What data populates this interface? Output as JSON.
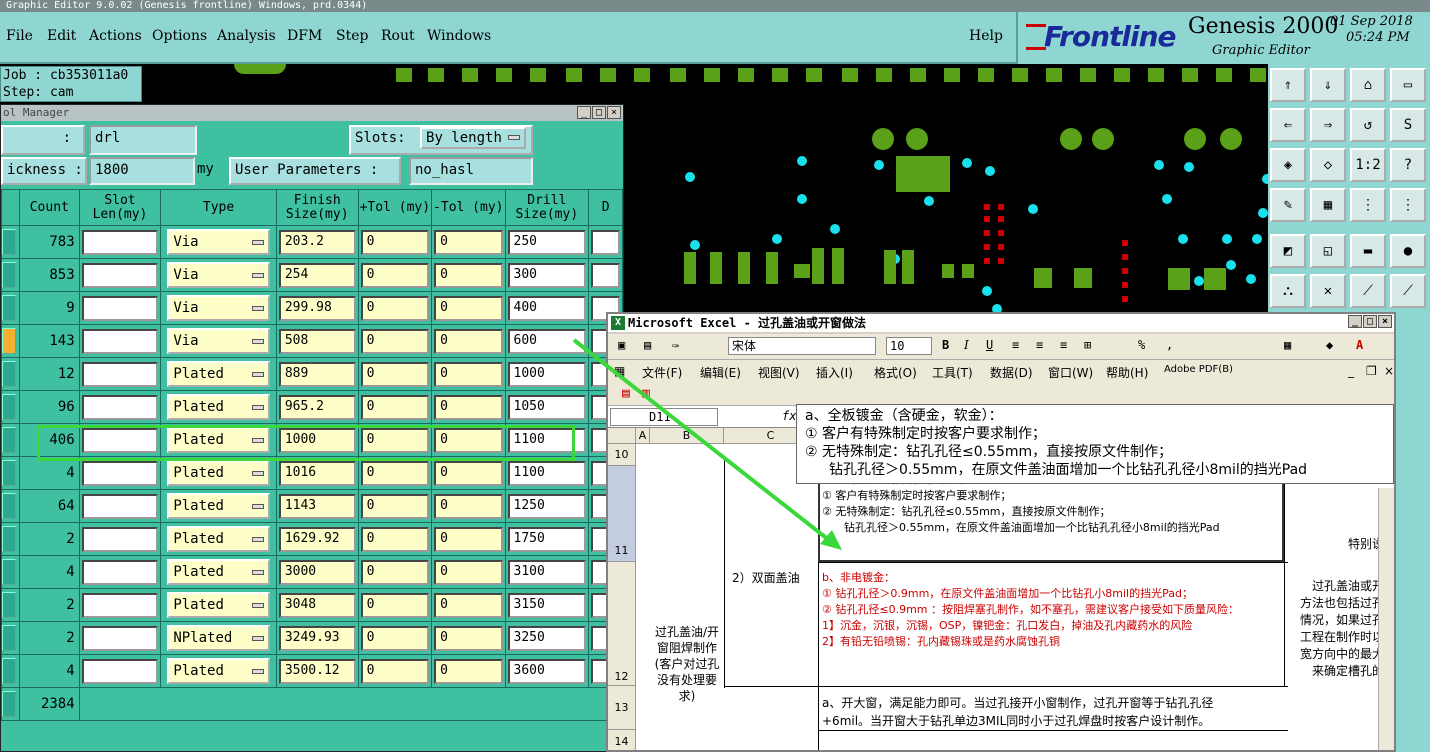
{
  "app": {
    "title_strip": "Graphic Editor 9.0.02 (Genesis  frontline) Windows, prd.0344)",
    "menu": [
      "File",
      "Edit",
      "Actions",
      "Options",
      "Analysis",
      "DFM",
      "Step",
      "Rout",
      "Windows"
    ],
    "help": "Help",
    "brand_logo": "Frontline",
    "product": "Genesis 2000",
    "product_sub": "Graphic Editor",
    "date": "01 Sep 2018",
    "time": "05:24 PM",
    "job": "Job : cb353011a0",
    "step": "Step: cam"
  },
  "toolmgr": {
    "title": "ol Manager",
    "layer_label": ":",
    "layer_value": "drl",
    "slots_label": "Slots:",
    "slots_value": "By length",
    "thickness_label": "ickness :",
    "thickness_value": "1800",
    "thickness_unit": "my",
    "user_params_label": "User Parameters :",
    "user_params_value": "no_hasl",
    "headers": [
      "Count",
      "Slot Len(my)",
      "Type",
      "Finish Size(my)",
      "+Tol (my)",
      "-Tol (my)",
      "Drill Size(my)",
      "D"
    ],
    "rows": [
      {
        "count": "783",
        "type": "Via",
        "finish": "203.2",
        "ptol": "0",
        "mtol": "0",
        "drill": "250"
      },
      {
        "count": "853",
        "type": "Via",
        "finish": "254",
        "ptol": "0",
        "mtol": "0",
        "drill": "300"
      },
      {
        "count": "9",
        "type": "Via",
        "finish": "299.98",
        "ptol": "0",
        "mtol": "0",
        "drill": "400"
      },
      {
        "count": "143",
        "type": "Via",
        "finish": "508",
        "ptol": "0",
        "mtol": "0",
        "drill": "600"
      },
      {
        "count": "12",
        "type": "Plated",
        "finish": "889",
        "ptol": "0",
        "mtol": "0",
        "drill": "1000"
      },
      {
        "count": "96",
        "type": "Plated",
        "finish": "965.2",
        "ptol": "0",
        "mtol": "0",
        "drill": "1050"
      },
      {
        "count": "406",
        "type": "Plated",
        "finish": "1000",
        "ptol": "0",
        "mtol": "0",
        "drill": "1100"
      },
      {
        "count": "4",
        "type": "Plated",
        "finish": "1016",
        "ptol": "0",
        "mtol": "0",
        "drill": "1100"
      },
      {
        "count": "64",
        "type": "Plated",
        "finish": "1143",
        "ptol": "0",
        "mtol": "0",
        "drill": "1250"
      },
      {
        "count": "2",
        "type": "Plated",
        "finish": "1629.92",
        "ptol": "0",
        "mtol": "0",
        "drill": "1750"
      },
      {
        "count": "4",
        "type": "Plated",
        "finish": "3000",
        "ptol": "0",
        "mtol": "0",
        "drill": "3100"
      },
      {
        "count": "2",
        "type": "Plated",
        "finish": "3048",
        "ptol": "0",
        "mtol": "0",
        "drill": "3150"
      },
      {
        "count": "2",
        "type": "NPlated",
        "finish": "3249.93",
        "ptol": "0",
        "mtol": "0",
        "drill": "3250"
      },
      {
        "count": "4",
        "type": "Plated",
        "finish": "3500.12",
        "ptol": "0",
        "mtol": "0",
        "drill": "3600"
      }
    ],
    "total": "2384"
  },
  "excel": {
    "title": "Microsoft Excel - 过孔盖油或开窗做法",
    "font_name": "宋体",
    "font_size": "10",
    "menu": [
      "文件(F)",
      "编辑(E)",
      "视图(V)",
      "插入(I)",
      "格式(O)",
      "工具(T)",
      "数据(D)",
      "窗口(W)",
      "帮助(H)",
      "Adobe PDF(B)"
    ],
    "name_box": "D11",
    "fx": "fx",
    "cols": [
      "A",
      "B",
      "C"
    ],
    "rows": [
      "10",
      "11",
      "12",
      "13",
      "14"
    ],
    "cell_b": "过孔盖油/开窗阻焊制作(客户对过孔没有处理要求)",
    "cell_c": "2）双面盖油",
    "d11_l1": "a、全板镀金（含硬金，软金）：",
    "d11_l2": "① 客户有特殊制定时按客户要求制作；",
    "d11_l3": "② 无特殊制定：钻孔孔径≤0.55mm，直接按原文件制作；",
    "d11_l4": "钻孔孔径＞0.55mm，在原文件盖油面增加一个比钻孔孔径小8mil的挡光Pad",
    "d12_l1": "b、非电镀金：",
    "d12_l2": "① 钻孔孔径＞0.9mm，在原文件盖油面增加一个比钻孔小8mil的挡光Pad；",
    "d12_l3": "② 钻孔孔径≤0.9mm ：按阻焊塞孔制作，如不塞孔，需建议客户接受如下质量风险：",
    "d12_l4": "1】沉金，沉银，沉锡，OSP，镍钯金：孔口发白，掉油及孔内藏药水的风险",
    "d12_l5": "2】有铅无铅喷锡：孔内藏锡珠或是药水腐蚀孔铜",
    "d13_l1": "a、开大窗，满足能力即可。当过孔接开小窗制作，过孔开窗等于钻孔孔径",
    "d13_l2": "+6mil。当开窗大于钻孔单边3MIL同时小于过孔焊盘时按客户设计制作。",
    "e11": "特别说",
    "e12_l1": "过孔盖油或开",
    "e12_l2": "方法也包括过孔",
    "e12_l3": "情况，如果过孔",
    "e12_l4": "工程在制作时以",
    "e12_l5": "宽方向中的最大",
    "e12_l6": "来确定槽孔的"
  },
  "tooltip": {
    "l1": "a、全板镀金（含硬金，软金）：",
    "l2": "① 客户有特殊制定时按客户要求制作；",
    "l3": "② 无特殊制定：钻孔孔径≤0.55mm，直接按原文件制作；",
    "l4": "钻孔孔径＞0.55mm，在原文件盖油面增加一个比钻孔孔径小8mil的挡光Pad"
  },
  "colors": {
    "accent_green": "#3ad83a",
    "panel_teal": "#3fc0a0",
    "menubar": "#8fd6d2"
  }
}
